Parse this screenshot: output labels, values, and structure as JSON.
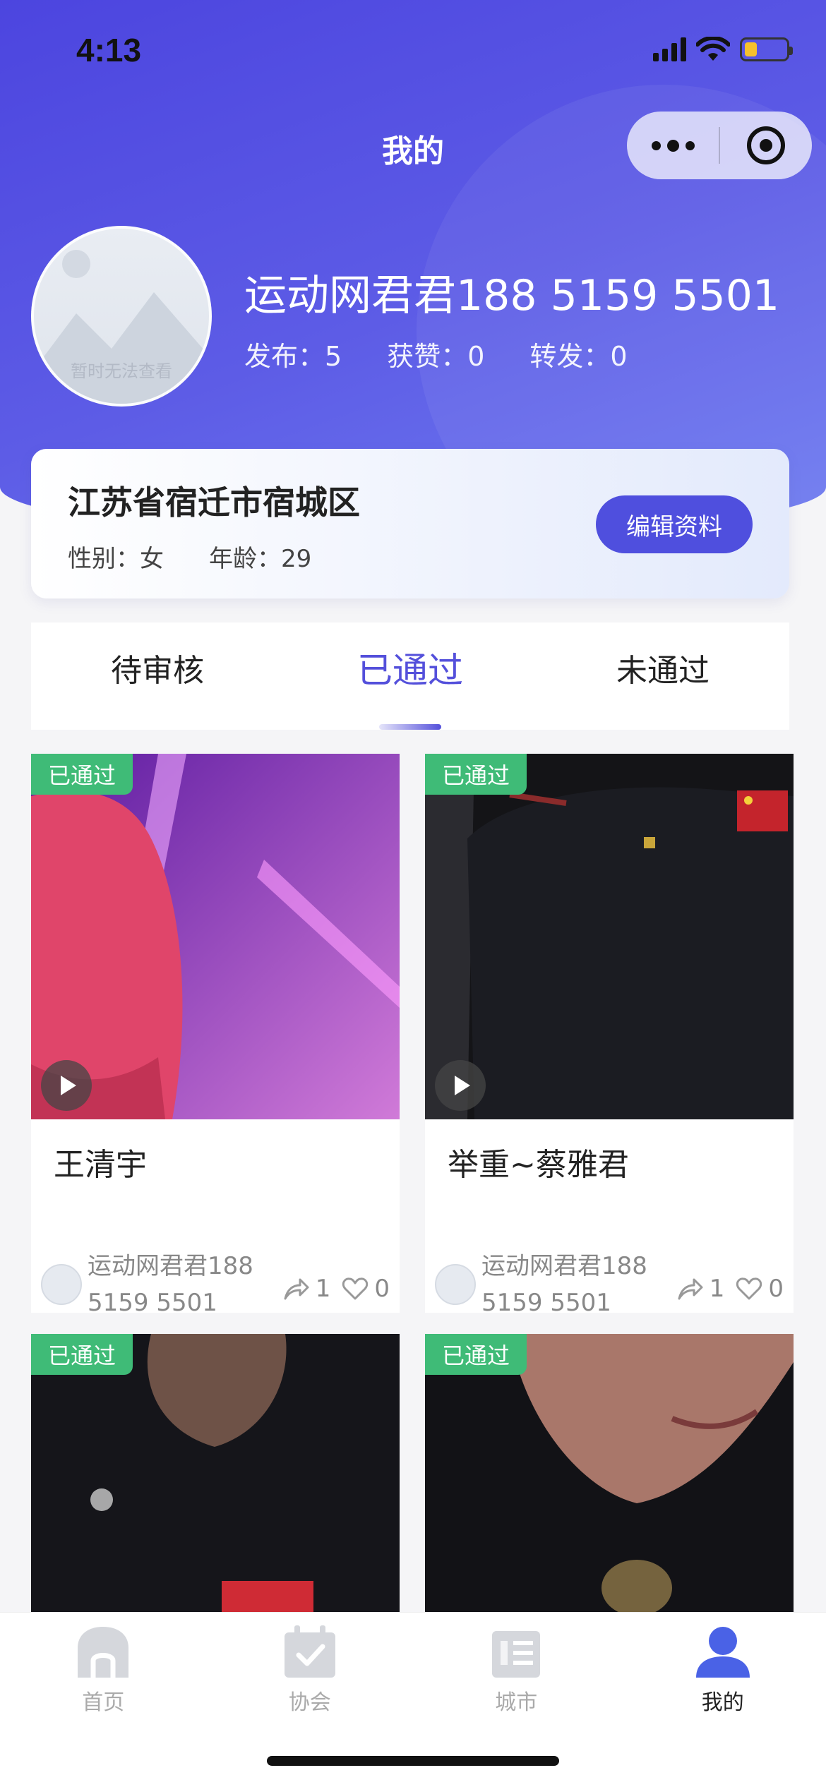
{
  "status_bar": {
    "time": "4:13"
  },
  "nav": {
    "title": "我的"
  },
  "profile": {
    "avatar_caption": "暂时无法查看",
    "name": "运动网君君188 5159 5501",
    "stats": [
      "发布：5",
      "获赞：0",
      "转发：0"
    ]
  },
  "info_card": {
    "region": "江苏省宿迁市宿城区",
    "gender": "性别：女",
    "age": "年龄：29",
    "edit_label": "编辑资料"
  },
  "tabs": [
    {
      "label": "待审核",
      "active": false
    },
    {
      "label": "已通过",
      "active": true
    },
    {
      "label": "未通过",
      "active": false
    }
  ],
  "posts": [
    {
      "badge": "已通过",
      "title": "王清宇",
      "author": "运动网君君188 5159 5501",
      "shares": "1",
      "likes": "0"
    },
    {
      "badge": "已通过",
      "title": "举重~蔡雅君",
      "author": "运动网君君188 5159 5501",
      "shares": "1",
      "likes": "0"
    },
    {
      "badge": "已通过"
    },
    {
      "badge": "已通过"
    }
  ],
  "tabbar": [
    {
      "label": "首页",
      "icon": "home-icon"
    },
    {
      "label": "协会",
      "icon": "calendar-check-icon"
    },
    {
      "label": "城市",
      "icon": "list-document-icon"
    },
    {
      "label": "我的",
      "icon": "user-icon"
    }
  ],
  "colors": {
    "accent": "#5450db",
    "badge": "#3fbb77",
    "header_gradient": [
      "#4c45df",
      "#6e7bf0"
    ]
  }
}
